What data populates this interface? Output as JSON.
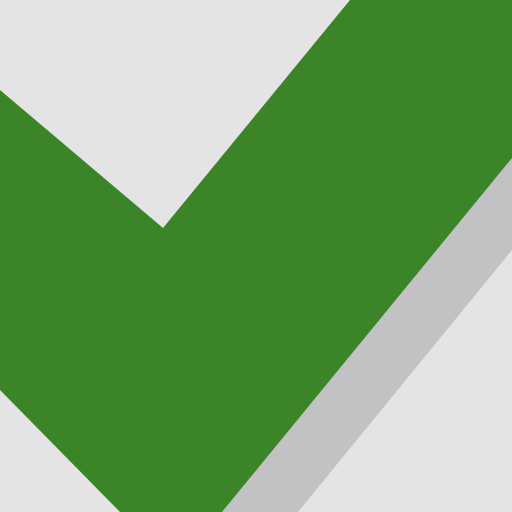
{
  "icon": {
    "name": "checkmark-icon",
    "colors": {
      "background": "#e4e4e5",
      "checkmark": "#3b8428",
      "shadow": "#c2c2c4"
    }
  }
}
